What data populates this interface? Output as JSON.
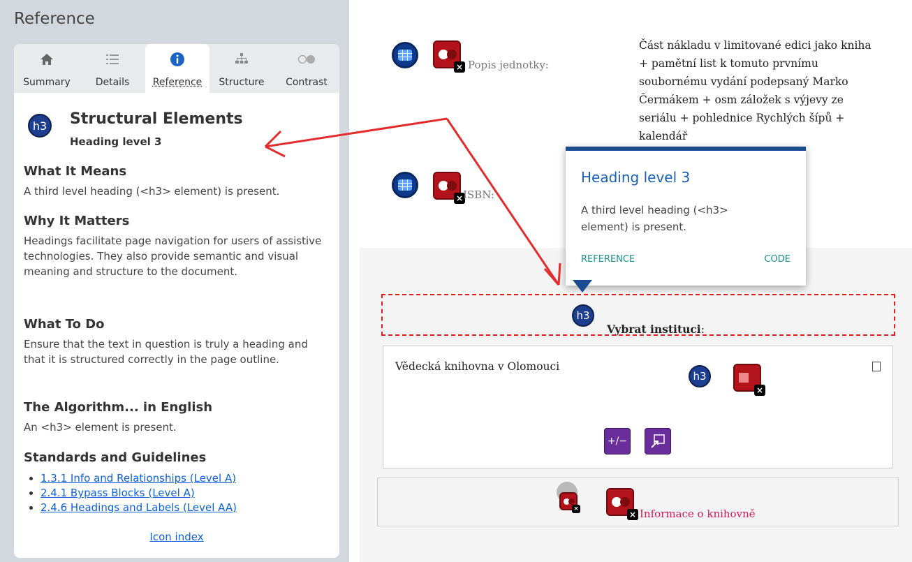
{
  "panel": {
    "title": "Reference",
    "tabs": [
      {
        "label": "Summary",
        "icon": "home-icon"
      },
      {
        "label": "Details",
        "icon": "list-icon"
      },
      {
        "label": "Reference",
        "icon": "info-icon",
        "active": true
      },
      {
        "label": "Structure",
        "icon": "sitemap-icon"
      },
      {
        "label": "Contrast",
        "icon": "contrast-icon"
      }
    ],
    "reference": {
      "badge": "h3",
      "title": "Structural Elements",
      "subtitle": "Heading level 3",
      "what_it_means_h": "What It Means",
      "what_it_means": "A third level heading (<h3> element) is present.",
      "why_it_matters_h": "Why It Matters",
      "why_it_matters": "Headings facilitate page navigation for users of assistive technologies. They also provide semantic and visual meaning and structure to the document.",
      "what_to_do_h": "What To Do",
      "what_to_do": "Ensure that the text in question is truly a heading and that it is structured correctly in the page outline.",
      "algorithm_h": "The Algorithm... in English",
      "algorithm": "An <h3> element is present.",
      "standards_h": "Standards and Guidelines",
      "standards": [
        "1.3.1 Info and Relationships (Level A)",
        "2.4.1 Bypass Blocks (Level A)",
        "2.4.6 Headings and Labels (Level AA)"
      ],
      "icon_index": "Icon index"
    }
  },
  "page": {
    "popis_label": "Popis jednotky:",
    "description": "Část nákladu v limitované edici jako kniha + pamětní list k tomuto prvnímu soubornému vydání podepsaný Marko Čermákem + osm záložek s výjevy ze seriálu + pohlednice Rychlých šípů + kalendář",
    "isbn_label": "ISBN:",
    "h3_badge": "h3",
    "vybrat": "Vybrat instituci",
    "vybrat_colon": ":",
    "institution": "Vědecká knihovna v Olomouci",
    "plusminus": "+/−",
    "info_link": "Informace o knihovně",
    "error_x": "×"
  },
  "tooltip": {
    "title": "Heading level 3",
    "text": "A third level heading (<h3> element) is present.",
    "reference": "REFERENCE",
    "code": "CODE"
  },
  "colors": {
    "panel_bg": "#d3d8de",
    "accent_blue": "#1b4c91",
    "link_blue": "#0d61d8",
    "error_red": "#b3141b",
    "dashed_red": "#e11c1c",
    "teal": "#1a8f8f",
    "pink_link": "#d6175c",
    "purple": "#6a2d9c"
  }
}
